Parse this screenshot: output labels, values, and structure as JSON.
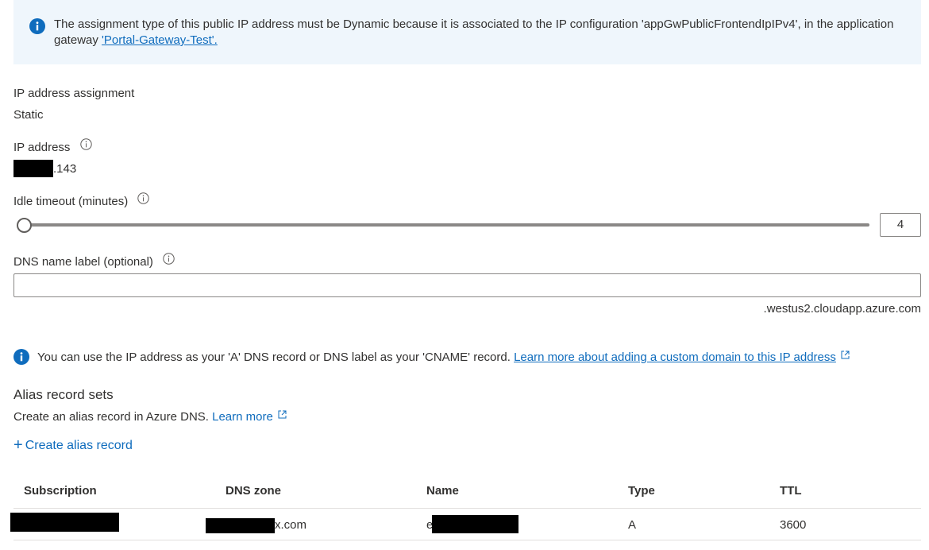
{
  "banner": {
    "text_prefix": "The assignment type of this public IP address must be Dynamic because it is associated to the IP configuration 'appGwPublicFrontendIpIPv4', in the application gateway ",
    "link_text": "'Portal-Gateway-Test'.",
    "icon": "info-icon",
    "bg_color": "#eff6fc",
    "icon_color": "#0f6cbd"
  },
  "ip_assignment": {
    "label": "IP address assignment",
    "value": "Static"
  },
  "ip_address": {
    "label": "IP address",
    "value_suffix": ".143"
  },
  "idle_timeout": {
    "label": "Idle timeout (minutes)",
    "value": "4"
  },
  "dns_label": {
    "label": "DNS name label (optional)",
    "value": "",
    "suffix": ".westus2.cloudapp.azure.com"
  },
  "dns_info": {
    "text": "You can use the IP address as your 'A' DNS record or DNS label as your 'CNAME' record.",
    "link_text": "Learn more about adding a custom domain to this IP address"
  },
  "alias": {
    "title": "Alias record sets",
    "description": "Create an alias record in Azure DNS.",
    "learn_more": "Learn more",
    "create_label": "Create alias record"
  },
  "table": {
    "columns": [
      "Subscription",
      "DNS zone",
      "Name",
      "Type",
      "TTL"
    ],
    "rows": [
      {
        "subscription": "",
        "dns_zone_suffix": "x.com",
        "name_prefix": "e",
        "type": "A",
        "ttl": "3600"
      }
    ]
  },
  "colors": {
    "accent": "#0f6cbd",
    "text": "#323130",
    "border": "#8a8886"
  }
}
